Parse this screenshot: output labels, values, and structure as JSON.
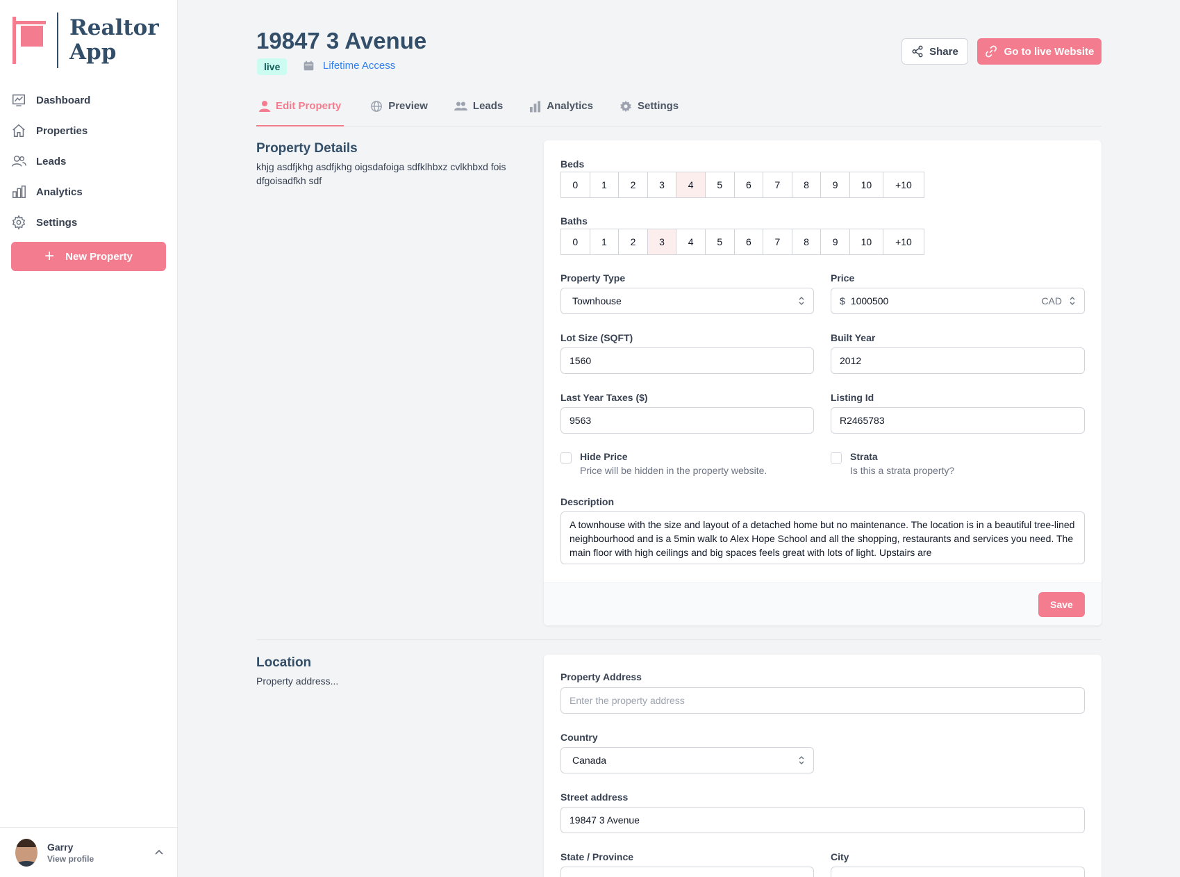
{
  "app": {
    "name_line1": "Realtor",
    "name_line2": "App"
  },
  "sidebar": {
    "items": [
      {
        "label": "Dashboard",
        "icon": "chart-icon"
      },
      {
        "label": "Properties",
        "icon": "home-icon"
      },
      {
        "label": "Leads",
        "icon": "users-icon"
      },
      {
        "label": "Analytics",
        "icon": "bar-chart-icon"
      },
      {
        "label": "Settings",
        "icon": "gear-icon"
      }
    ],
    "new_property_label": "New Property",
    "profile": {
      "name": "Garry",
      "sub": "View profile"
    }
  },
  "header": {
    "title": "19847 3 Avenue",
    "status_badge": "live",
    "access_label": "Lifetime Access",
    "share_label": "Share",
    "live_site_label": "Go to live Website"
  },
  "tabs": [
    {
      "label": "Edit Property",
      "active": true
    },
    {
      "label": "Preview"
    },
    {
      "label": "Leads"
    },
    {
      "label": "Analytics"
    },
    {
      "label": "Settings"
    }
  ],
  "details": {
    "title": "Property Details",
    "description": "khjg asdfjkhg asdfjkhg oigsdafoiga sdfklhbxz cvlkhbxd fois dfgoisadfkh sdf",
    "beds_label": "Beds",
    "baths_label": "Baths",
    "options": [
      "0",
      "1",
      "2",
      "3",
      "4",
      "5",
      "6",
      "7",
      "8",
      "9",
      "10",
      "+10"
    ],
    "beds_selected": "4",
    "baths_selected": "3",
    "property_type_label": "Property Type",
    "property_type_value": "Townhouse",
    "price_label": "Price",
    "price_symbol": "$",
    "price_value": "1000500",
    "price_currency": "CAD",
    "lot_size_label": "Lot Size (SQFT)",
    "lot_size_value": "1560",
    "built_year_label": "Built Year",
    "built_year_value": "2012",
    "taxes_label": "Last Year Taxes ($)",
    "taxes_value": "9563",
    "listing_id_label": "Listing Id",
    "listing_id_value": "R2465783",
    "hide_price_label": "Hide Price",
    "hide_price_help": "Price will be hidden in the property website.",
    "strata_label": "Strata",
    "strata_help": "Is this a strata property?",
    "description_label": "Description",
    "description_value": "A townhouse with the size and layout of a detached home but no maintenance. The location is in a beautiful tree-lined neighbourhood and is a 5min walk to Alex Hope School and all the shopping, restaurants and services you need. The main floor with high ceilings and big spaces feels great with lots of light. Upstairs are",
    "save_label": "Save"
  },
  "location": {
    "title": "Location",
    "description": "Property address...",
    "address_label": "Property Address",
    "address_placeholder": "Enter the property address",
    "country_label": "Country",
    "country_value": "Canada",
    "street_label": "Street address",
    "street_value": "19847 3 Avenue",
    "state_label": "State / Province",
    "city_label": "City"
  },
  "colors": {
    "brand": "#f47c8f",
    "navy": "#334e68",
    "link": "#2f80ed"
  }
}
